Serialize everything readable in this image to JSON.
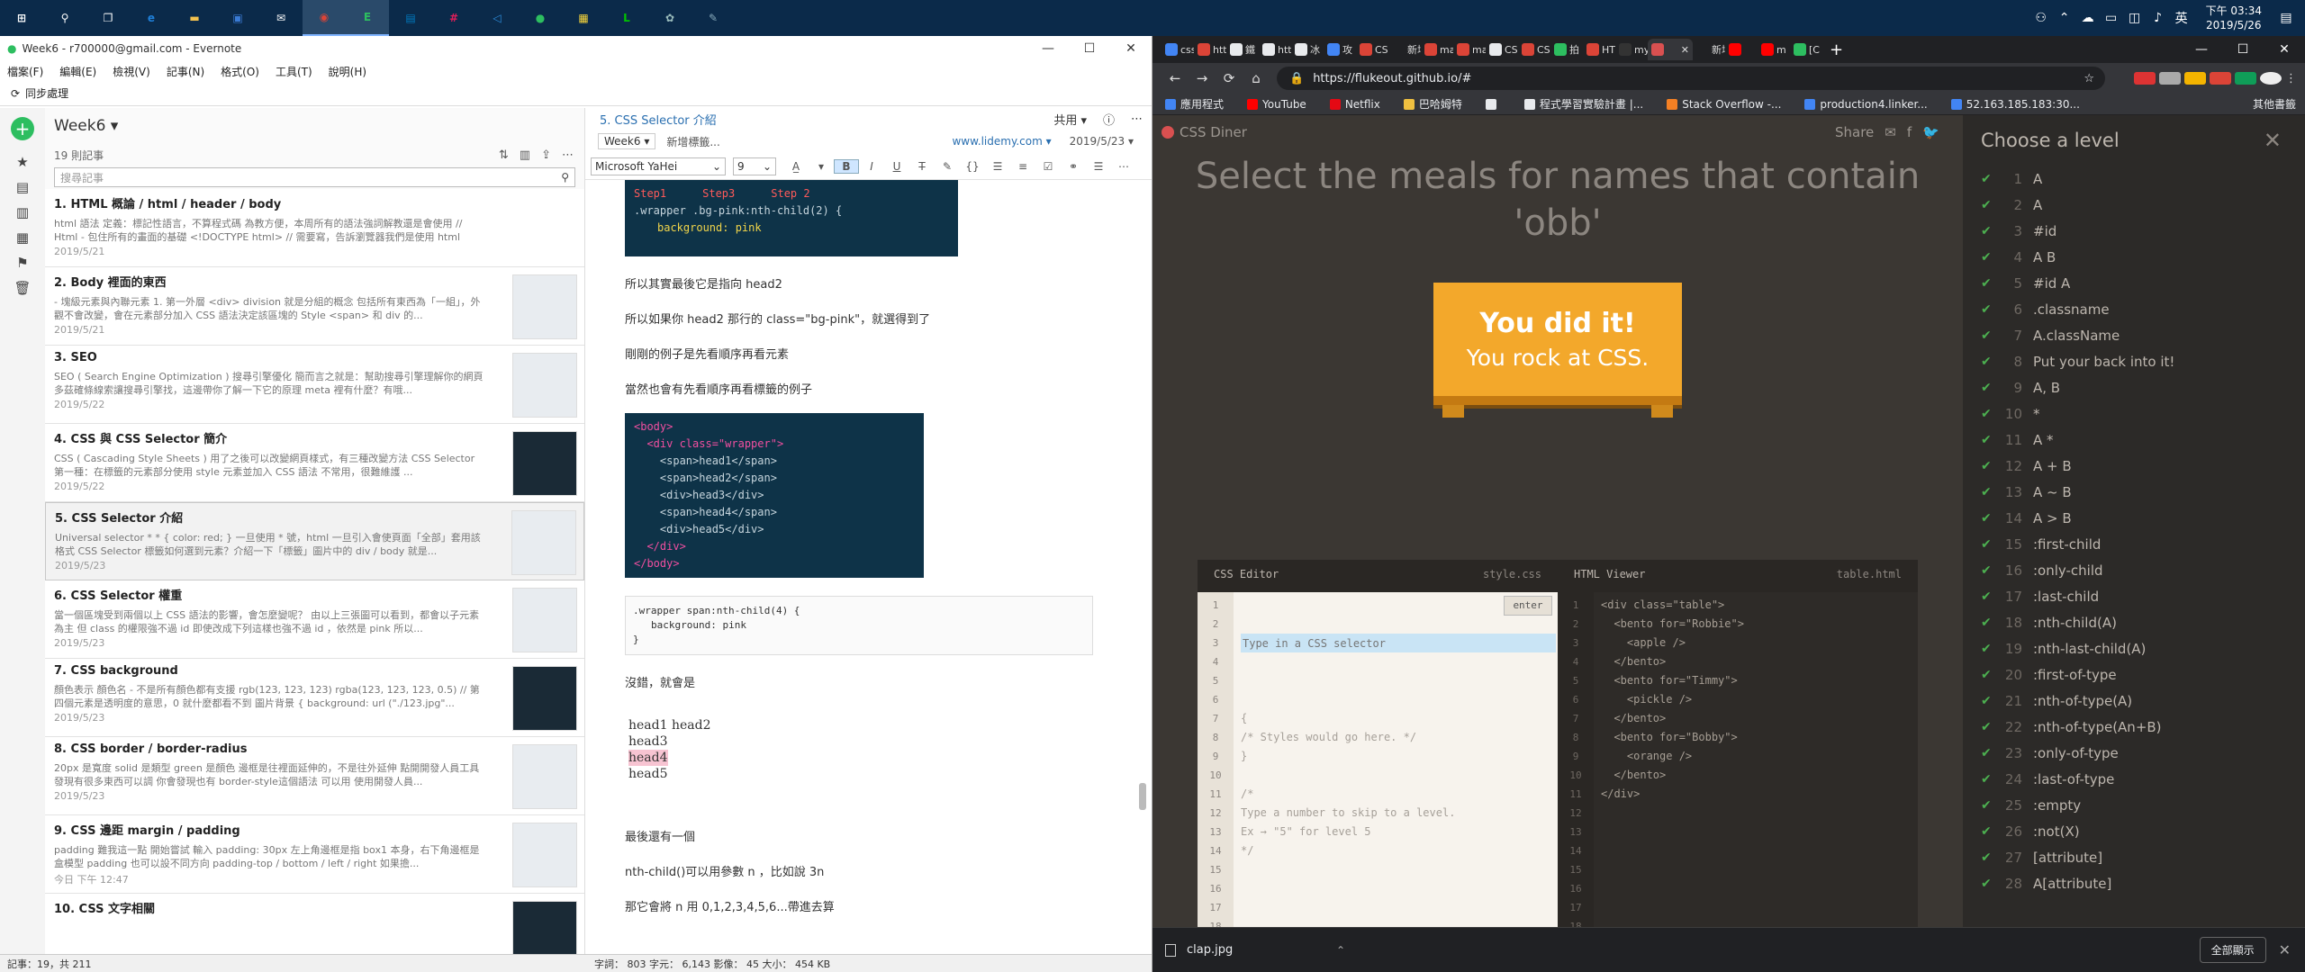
{
  "taskbar": {
    "icons": [
      {
        "name": "start-icon",
        "glyph": "⊞",
        "color": "#ffffff"
      },
      {
        "name": "search-icon",
        "glyph": "⚲",
        "color": "#ffffff"
      },
      {
        "name": "task-view-icon",
        "glyph": "❐",
        "color": "#ffffff"
      },
      {
        "name": "edge-icon",
        "glyph": "e",
        "color": "#1f7fd8"
      },
      {
        "name": "file-explorer-icon",
        "glyph": "▬",
        "color": "#f2c14e"
      },
      {
        "name": "store-icon",
        "glyph": "▣",
        "color": "#3a7bd5"
      },
      {
        "name": "mail-icon",
        "glyph": "✉",
        "color": "#ffffff"
      },
      {
        "name": "chrome-icon",
        "glyph": "◉",
        "color": "#db4437"
      },
      {
        "name": "evernote-icon",
        "glyph": "E",
        "color": "#2dbe60"
      },
      {
        "name": "trello-icon",
        "glyph": "▤",
        "color": "#0079bf"
      },
      {
        "name": "slack-icon",
        "glyph": "#",
        "color": "#e01e5a"
      },
      {
        "name": "vscode-icon",
        "glyph": "◁",
        "color": "#2d8fe0"
      },
      {
        "name": "app-green-icon",
        "glyph": "●",
        "color": "#2dbe60"
      },
      {
        "name": "sticky-notes-icon",
        "glyph": "▦",
        "color": "#f6d43a"
      },
      {
        "name": "line-icon",
        "glyph": "L",
        "color": "#00c300"
      },
      {
        "name": "app-misc-icon",
        "glyph": "✿",
        "color": "#9bb"
      },
      {
        "name": "notepad-icon",
        "glyph": "✎",
        "color": "#8ab"
      }
    ],
    "clock_time": "下午 03:34",
    "clock_date": "2019/5/26"
  },
  "evernote": {
    "title": "Week6 - r700000@gmail.com - Evernote",
    "menu": [
      "檔案(F)",
      "編輯(E)",
      "檢視(V)",
      "記事(N)",
      "格式(O)",
      "工具(T)",
      "說明(H)"
    ],
    "sync_label": "同步處理",
    "notebook_name": "Week6 ▾",
    "note_count": "19 則記事",
    "search_placeholder": "搜尋記事",
    "notes": [
      {
        "title": "1. HTML 概論 / html / header / body",
        "snippet": "html 語法 定義：標記性語言，不算程式碼 為教方便，本周所有的語法強詞解教還是會使用 // Html - 包住所有的畫面的基礎 <!DOCTYPE html> // 需要寫，告訴瀏覽器我們是使用 html <html> <header> <...",
        "date": "2019/5/21",
        "thumb": false
      },
      {
        "title": "2. Body 裡面的東西",
        "snippet": "- 塊級元素與內聯元素 1. 第一外層 <div> division 就是分組的概念 包括所有東西為「一組」，外觀不會改變，會在元素部分加入 CSS 語法決定該區塊的 Style <span> 和 div 的...",
        "date": "2019/5/21",
        "thumb": true
      },
      {
        "title": "3. SEO",
        "snippet": "SEO ( Search Engine Optimization ) 搜尋引擎優化 簡而言之就是：幫助搜尋引擎理解你的網頁 多茲確條線索讓搜尋引擎找，這邊帶你了解一下它的原理 meta 裡有什麼？有哦...",
        "date": "2019/5/22",
        "thumb": true
      },
      {
        "title": "4. CSS 與 CSS Selector 簡介",
        "snippet": "CSS ( Cascading Style Sheets ) 用了之後可以改變網頁樣式，有三種改變方法 CSS Selector 第一種：在標籤的元素部分使用 style 元素並加入 CSS 語法 不常用，很難維護 ...",
        "date": "2019/5/22",
        "thumb": true
      },
      {
        "title": "5. CSS Selector 介紹",
        "snippet": "Universal selector * * { color: red; } 一旦使用 * 號，html 一旦引入會使頁面「全部」套用該格式 CSS Selector 標籤如何選到元素？介紹一下「標籤」圖片中的 div / body 就是...",
        "date": "2019/5/23",
        "thumb": true
      },
      {
        "title": "6. CSS Selector 權重",
        "snippet": "當一個區塊受到兩個以上 CSS 語法的影響，會怎麼變呢？ 由以上三張圖可以看到，都會以子元素為主 但 class 的權限強不過 id 即使改成下列這樣也強不過 id ，依然是 pink 所以...",
        "date": "2019/5/23",
        "thumb": true
      },
      {
        "title": "7. CSS background",
        "snippet": "顏色表示 顏色名 - 不是所有顏色都有支援 rgb(123, 123, 123) rgba(123, 123, 123, 0.5) // 第四個元素是透明度的意思，0 就什麼都看不到 圖片背景 { background: url (\"./123.jpg\"...",
        "date": "2019/5/23",
        "thumb": true
      },
      {
        "title": "8. CSS border / border-radius",
        "snippet": "20px 是寬度 solid 是類型 green 是顏色 邊框是往裡面延伸的，不是往外延伸 點開開發人員工具發現有很多東西可以調 你會發現也有 border-style這個語法 可以用 使用開發人員...",
        "date": "2019/5/23",
        "thumb": true
      },
      {
        "title": "9. CSS 邊距 margin / padding",
        "snippet": "padding 難我這一點 開始嘗試 輸入 padding: 30px 左上角邊框是指 box1 本身，右下角邊框是盒模型 padding 也可以設不同方向 padding-top / bottom / left / right 如果擔...",
        "date": "今日 下午 12:47",
        "thumb": true
      },
      {
        "title": "10. CSS 文字相關",
        "snippet": "",
        "date": "",
        "thumb": true
      }
    ],
    "editor": {
      "title": "5. CSS Selector 介紹",
      "share_label": "共用 ▾",
      "notebook_chip": "Week6 ▾",
      "tag_placeholder": "新增標籤...",
      "source_url": "www.lidemy.com ▾",
      "note_date": "2019/5/23 ▾",
      "font_name": "Microsoft YaHei",
      "font_size": "9",
      "code1_steps": [
        "Step1",
        "Step3",
        "Step 2"
      ],
      "code1_line": ".wrapper .bg-pink:nth-child(2) {",
      "code1_line2": "background: pink",
      "para1": "所以其實最後它是指向 head2",
      "para2": "所以如果你 head2 那行的 class=\"bg-pink\"，就選得到了",
      "para3": "剛剛的例子是先看順序再看元素",
      "para4": "當然也會有先看順序再看標籤的例子",
      "code2": [
        "<body>",
        "  <div class=\"wrapper\">",
        "    <span>head1</span>",
        "    <span>head2</span>",
        "    <div>head3</div>",
        "    <span>head4</span>",
        "    <div>head5</div>",
        "  </div>",
        "</body>"
      ],
      "code3_line1": ".wrapper span:nth-child(4) {",
      "code3_line2": "background: pink",
      "code3_line3": "}",
      "para5": "沒錯，就會是",
      "result_line1": "head1 head2",
      "result_line2": "head3",
      "result_line3": "head4",
      "result_line4": "head5",
      "para6": "最後還有一個",
      "para7": "nth-child()可以用參數 n ，比如說 3n",
      "para8": "那它會將 n 用 0,1,2,3,4,5,6...帶進去算"
    },
    "status_left": "記事：19，共 211",
    "status_right": "字詞： 803   字元： 6,143   影像： 45   大小： 454 KB"
  },
  "chrome": {
    "tabs": [
      {
        "label": "css:",
        "color": "#4285f4"
      },
      {
        "label": "htt",
        "color": "#db4437"
      },
      {
        "label": "鐵",
        "color": "#e8eaed"
      },
      {
        "label": "htt",
        "color": "#e8eaed"
      },
      {
        "label": "冰",
        "color": "#e8eaed"
      },
      {
        "label": "攻",
        "color": "#4285f4"
      },
      {
        "label": "CS",
        "color": "#db4437"
      },
      {
        "label": "新增分",
        "color": "#202124"
      },
      {
        "label": "ma",
        "color": "#db4437"
      },
      {
        "label": "ma",
        "color": "#db4437"
      },
      {
        "label": "CS",
        "color": "#e8eaed"
      },
      {
        "label": "CS",
        "color": "#db4437"
      },
      {
        "label": "拍",
        "color": "#2dbe60"
      },
      {
        "label": "HT",
        "color": "#db4437"
      },
      {
        "label": "my",
        "color": "#333"
      },
      {
        "label": "",
        "color": "#d95050",
        "active": true
      },
      {
        "label": "新增分",
        "color": "#202124"
      },
      {
        "label": "",
        "color": "#f00"
      },
      {
        "label": "m",
        "color": "#f00"
      },
      {
        "label": "[C",
        "color": "#2dbe60"
      }
    ],
    "url": "https://flukeout.github.io/#",
    "bookmarks": [
      {
        "label": "應用程式",
        "color": "#4285f4"
      },
      {
        "label": "YouTube",
        "color": "#ff0000"
      },
      {
        "label": "Netflix",
        "color": "#e50914"
      },
      {
        "label": "巴哈姆特",
        "color": "#f0c040"
      },
      {
        "label": "",
        "color": "#e8eaed"
      },
      {
        "label": "程式學習實驗計畫 |...",
        "color": "#e8eaed"
      },
      {
        "label": "Stack Overflow -...",
        "color": "#f48024"
      },
      {
        "label": "production4.linker...",
        "color": "#4285f4"
      },
      {
        "label": "52.163.185.183:30...",
        "color": "#4285f4"
      }
    ],
    "other_bookmarks": "其他書籤",
    "download_file": "clap.jpg",
    "show_all": "全部顯示"
  },
  "diner": {
    "logo": "CSS Diner",
    "share_label": "Share",
    "instruction": "Select the meals for names that contain 'obb'",
    "success_line1": "You did it!",
    "success_line2": "You rock at CSS.",
    "css_editor_label": "CSS Editor",
    "css_file": "style.css",
    "html_viewer_label": "HTML Viewer",
    "html_file": "table.html",
    "selector_placeholder": "Type in a CSS selector",
    "enter_label": "enter",
    "css_lines_text": "\n{\n/* Styles would go here. */\n}\n\n/*\nType a number to skip to a level.\nEx → \"5\" for level 5\n*/",
    "html_lines_text": "<div class=\"table\">\n  <bento for=\"Robbie\">\n    <apple />\n  </bento>\n  <bento for=\"Timmy\">\n    <pickle />\n  </bento>\n  <bento for=\"Bobby\">\n    <orange />\n  </bento>\n</div>",
    "gutter_count": 19,
    "levels_title": "Choose a level",
    "levels": [
      {
        "n": "1",
        "label": "A"
      },
      {
        "n": "2",
        "label": "A"
      },
      {
        "n": "3",
        "label": "#id"
      },
      {
        "n": "4",
        "label": "A B"
      },
      {
        "n": "5",
        "label": "#id A"
      },
      {
        "n": "6",
        "label": ".classname"
      },
      {
        "n": "7",
        "label": "A.className"
      },
      {
        "n": "8",
        "label": "Put your back into it!"
      },
      {
        "n": "9",
        "label": "A, B"
      },
      {
        "n": "10",
        "label": "*"
      },
      {
        "n": "11",
        "label": "A *"
      },
      {
        "n": "12",
        "label": "A + B"
      },
      {
        "n": "13",
        "label": "A ~ B"
      },
      {
        "n": "14",
        "label": "A > B"
      },
      {
        "n": "15",
        "label": ":first-child"
      },
      {
        "n": "16",
        "label": ":only-child"
      },
      {
        "n": "17",
        "label": ":last-child"
      },
      {
        "n": "18",
        "label": ":nth-child(A)"
      },
      {
        "n": "19",
        "label": ":nth-last-child(A)"
      },
      {
        "n": "20",
        "label": ":first-of-type"
      },
      {
        "n": "21",
        "label": ":nth-of-type(A)"
      },
      {
        "n": "22",
        "label": ":nth-of-type(An+B)"
      },
      {
        "n": "23",
        "label": ":only-of-type"
      },
      {
        "n": "24",
        "label": ":last-of-type"
      },
      {
        "n": "25",
        "label": ":empty"
      },
      {
        "n": "26",
        "label": ":not(X)"
      },
      {
        "n": "27",
        "label": "[attribute]"
      },
      {
        "n": "28",
        "label": "A[attribute]"
      }
    ]
  }
}
